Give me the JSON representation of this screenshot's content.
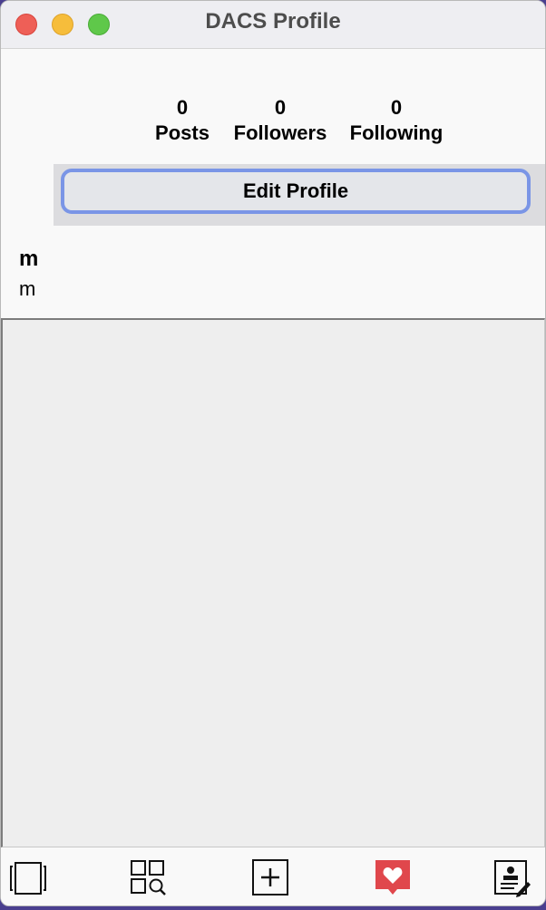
{
  "window": {
    "title": "DACS Profile"
  },
  "profile": {
    "stats": {
      "posts": {
        "count": "0",
        "label": "Posts"
      },
      "followers": {
        "count": "0",
        "label": "Followers"
      },
      "following": {
        "count": "0",
        "label": "Following"
      }
    },
    "edit_button_label": "Edit Profile",
    "name": "m",
    "bio": "m"
  },
  "bottom_nav": {
    "items": [
      {
        "icon": "feed-icon"
      },
      {
        "icon": "search-grid-icon"
      },
      {
        "icon": "add-post-icon"
      },
      {
        "icon": "activity-heart-icon"
      },
      {
        "icon": "profile-edit-icon"
      }
    ],
    "colors": {
      "activity": "#e0474c"
    }
  }
}
